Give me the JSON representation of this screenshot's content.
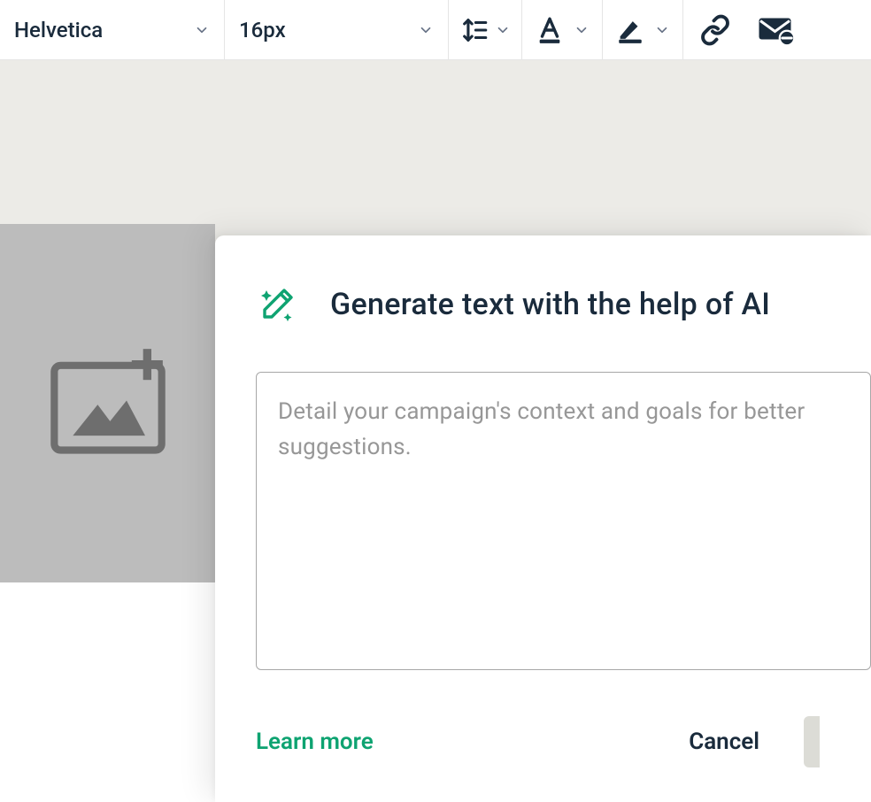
{
  "toolbar": {
    "font_family": "Helvetica",
    "font_size": "16px"
  },
  "modal": {
    "title": "Generate text with the help of AI",
    "placeholder": "Detail your campaign's context and goals for better suggestions.",
    "learn_more_label": "Learn more",
    "cancel_label": "Cancel"
  },
  "colors": {
    "accent": "#0ea371",
    "text_primary": "#1a2b3c",
    "muted": "#979797"
  }
}
